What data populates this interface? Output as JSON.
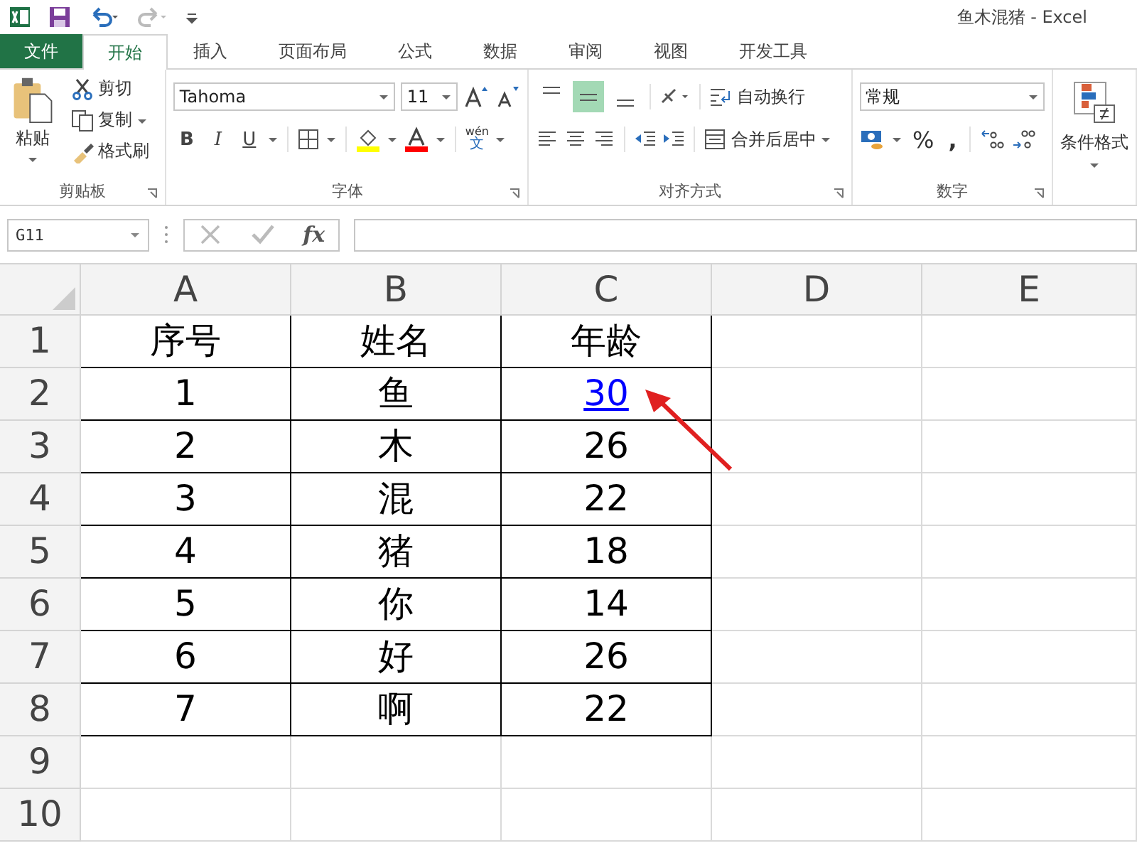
{
  "window": {
    "title": "鱼木混猪 - Excel"
  },
  "tabs": [
    {
      "label": "文件",
      "kind": "file",
      "selected": false
    },
    {
      "label": "开始",
      "kind": "tab",
      "selected": true
    },
    {
      "label": "插入",
      "kind": "tab",
      "selected": false
    },
    {
      "label": "页面布局",
      "kind": "tab",
      "selected": false
    },
    {
      "label": "公式",
      "kind": "tab",
      "selected": false
    },
    {
      "label": "数据",
      "kind": "tab",
      "selected": false
    },
    {
      "label": "审阅",
      "kind": "tab",
      "selected": false
    },
    {
      "label": "视图",
      "kind": "tab",
      "selected": false
    },
    {
      "label": "开发工具",
      "kind": "tab",
      "selected": false
    }
  ],
  "clipboard": {
    "paste": "粘贴",
    "cut": "剪切",
    "copy": "复制",
    "format_painter": "格式刷",
    "label": "剪贴板"
  },
  "font": {
    "name": "Tahoma",
    "size": "11",
    "bold": "B",
    "italic": "I",
    "underline": "U",
    "phonetic_top": "wén",
    "phonetic_bottom": "文",
    "label": "字体"
  },
  "alignment": {
    "vertical": [
      {
        "selected": false
      },
      {
        "selected": true
      },
      {
        "selected": false
      }
    ],
    "wrap": "自动换行",
    "merge": "合并后居中",
    "label": "对齐方式"
  },
  "number": {
    "format": "常规",
    "percent": "%",
    "comma": ",",
    "label": "数字"
  },
  "styles": {
    "conditional": "条件格式"
  },
  "formula_bar": {
    "name_box": "G11",
    "fx": "fx"
  },
  "sheet": {
    "columns": [
      "A",
      "B",
      "C",
      "D",
      "E"
    ],
    "rows": [
      {
        "header": "1",
        "cells": [
          {
            "text": "序号"
          },
          {
            "text": "姓名"
          },
          {
            "text": "年龄"
          }
        ]
      },
      {
        "header": "2",
        "cells": [
          {
            "text": "1"
          },
          {
            "text": "鱼"
          },
          {
            "text": "30",
            "kind": "link"
          }
        ]
      },
      {
        "header": "3",
        "cells": [
          {
            "text": "2"
          },
          {
            "text": "木"
          },
          {
            "text": "26"
          }
        ]
      },
      {
        "header": "4",
        "cells": [
          {
            "text": "3"
          },
          {
            "text": "混"
          },
          {
            "text": "22"
          }
        ]
      },
      {
        "header": "5",
        "cells": [
          {
            "text": "4"
          },
          {
            "text": "猪"
          },
          {
            "text": "18"
          }
        ]
      },
      {
        "header": "6",
        "cells": [
          {
            "text": "5"
          },
          {
            "text": "你"
          },
          {
            "text": "14"
          }
        ]
      },
      {
        "header": "7",
        "cells": [
          {
            "text": "6"
          },
          {
            "text": "好"
          },
          {
            "text": "26"
          }
        ]
      },
      {
        "header": "8",
        "cells": [
          {
            "text": "7"
          },
          {
            "text": "啊"
          },
          {
            "text": "22"
          }
        ]
      },
      {
        "header": "9",
        "cells": []
      },
      {
        "header": "10",
        "cells": []
      }
    ]
  }
}
